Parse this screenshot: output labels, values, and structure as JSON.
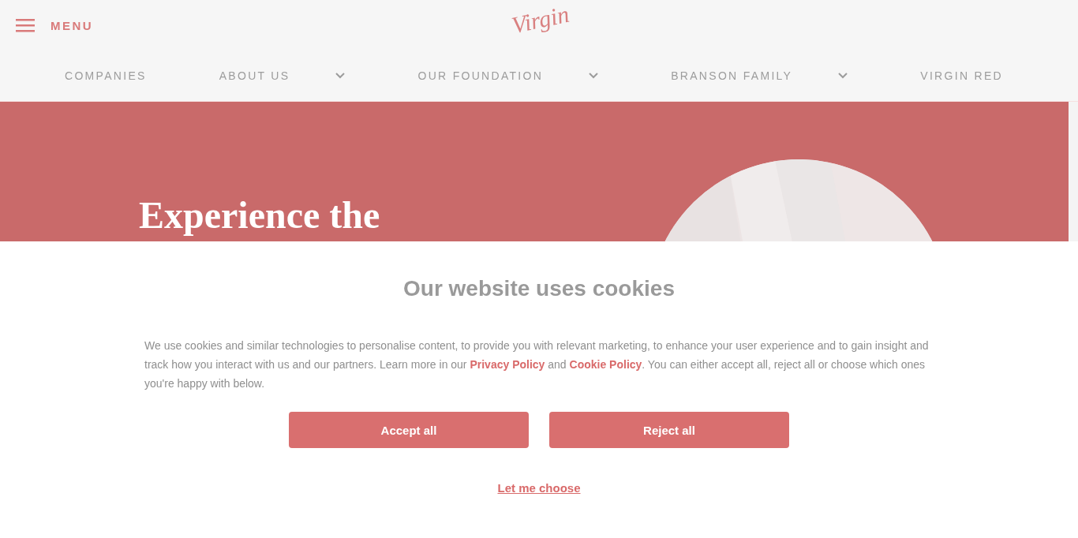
{
  "header": {
    "menu_label": "MENU",
    "logo": "Virgin"
  },
  "nav": [
    {
      "label": "COMPANIES",
      "has_dropdown": false
    },
    {
      "label": "ABOUT US",
      "has_dropdown": true
    },
    {
      "label": "OUR FOUNDATION",
      "has_dropdown": true
    },
    {
      "label": "BRANSON FAMILY",
      "has_dropdown": true
    },
    {
      "label": "VIRGIN RED",
      "has_dropdown": false
    }
  ],
  "hero": {
    "heading": "Experience the",
    "kind": "picture"
  },
  "cookie_banner": {
    "title": "Our website uses cookies",
    "text_parts": [
      {
        "kind": "text",
        "text": "We use cookies and similar technologies to personalise content, to provide you with relevant marketing, to enhance your user experience and to gain insight and track how you interact with us and our partners. Learn more in our "
      },
      {
        "kind": "link",
        "text": "Privacy Policy"
      },
      {
        "kind": "text",
        "text": " and "
      },
      {
        "kind": "link",
        "text": "Cookie Policy"
      },
      {
        "kind": "text",
        "text": ". You can either accept all, reject all or choose which ones you're happy with below."
      }
    ],
    "buttons": [
      "Accept all",
      "Reject all"
    ],
    "choose_link": "Let me choose"
  }
}
